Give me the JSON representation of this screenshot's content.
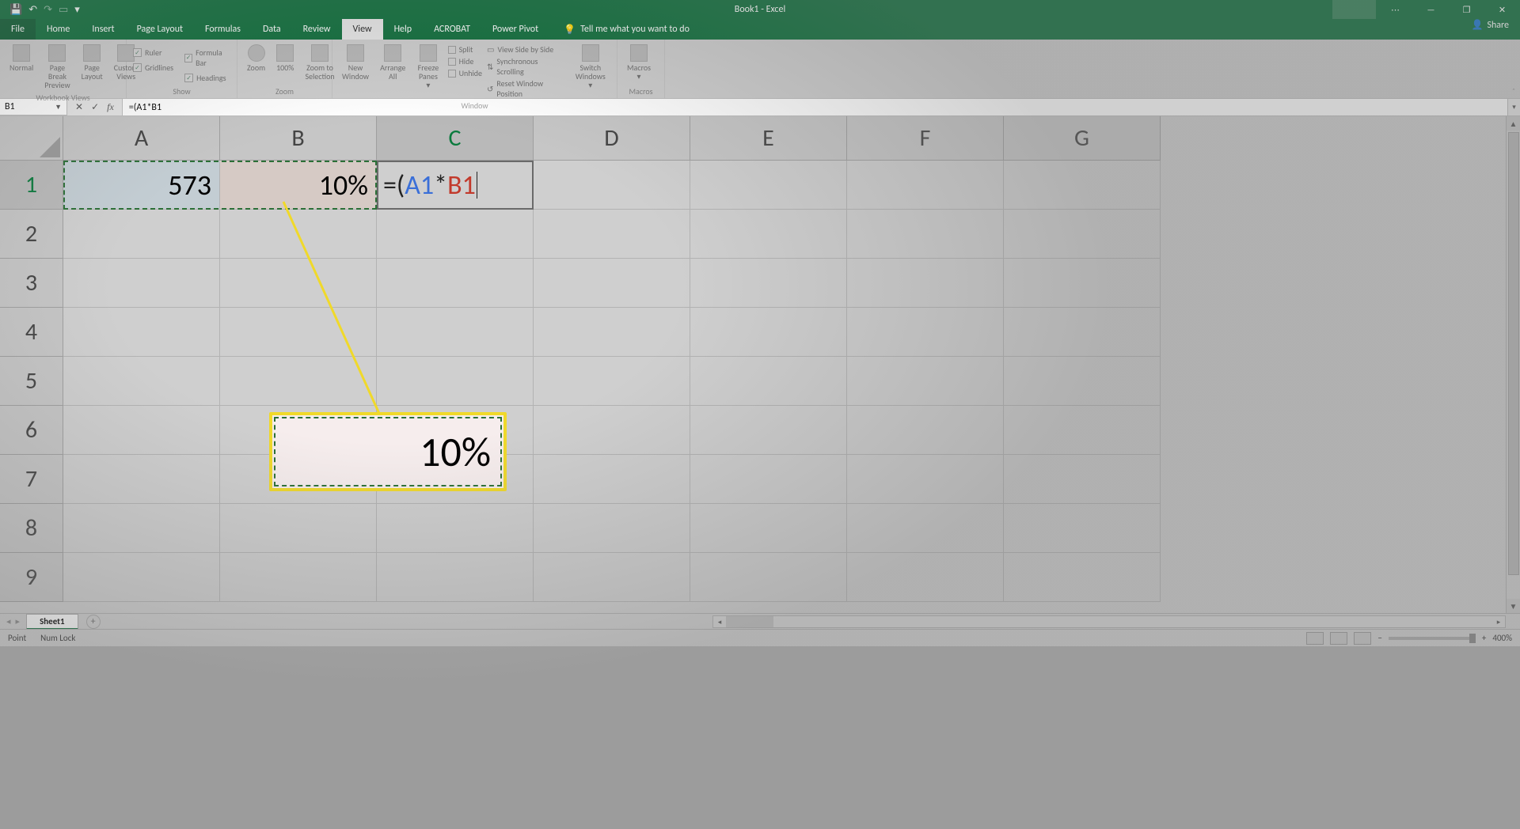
{
  "app": {
    "title": "Book1 - Excel"
  },
  "qat": {
    "save": "💾",
    "undo": "↶",
    "redo": "↷",
    "touch": "▭",
    "more": "▾"
  },
  "win": {
    "ribbon_opts": "⋯",
    "min": "—",
    "max": "❐",
    "close": "✕"
  },
  "tabs": {
    "file": "File",
    "home": "Home",
    "insert": "Insert",
    "page_layout": "Page Layout",
    "formulas": "Formulas",
    "data": "Data",
    "review": "Review",
    "view": "View",
    "help": "Help",
    "acrobat": "ACROBAT",
    "power_pivot": "Power Pivot",
    "tell_me": "Tell me what you want to do",
    "share": "Share"
  },
  "ribbon": {
    "workbook_views": {
      "label": "Workbook Views",
      "normal": "Normal",
      "page_break": "Page Break\nPreview",
      "page_layout": "Page\nLayout",
      "custom": "Custom\nViews"
    },
    "show": {
      "label": "Show",
      "ruler": "Ruler",
      "formula_bar": "Formula Bar",
      "gridlines": "Gridlines",
      "headings": "Headings"
    },
    "zoom": {
      "label": "Zoom",
      "zoom": "Zoom",
      "pct": "100%",
      "to_sel": "Zoom to\nSelection"
    },
    "window": {
      "label": "Window",
      "new": "New\nWindow",
      "arrange": "Arrange\nAll",
      "freeze": "Freeze\nPanes ▾",
      "split": "Split",
      "hide": "Hide",
      "unhide": "Unhide",
      "side": "View Side by Side",
      "sync": "Synchronous Scrolling",
      "reset": "Reset Window Position",
      "switch": "Switch\nWindows ▾"
    },
    "macros": {
      "label": "Macros",
      "macros": "Macros\n▾"
    }
  },
  "formula_bar": {
    "name_box": "B1",
    "cancel": "✕",
    "enter": "✓",
    "fx": "fx",
    "formula": "=(A1*B1"
  },
  "columns": [
    "A",
    "B",
    "C",
    "D",
    "E",
    "F",
    "G"
  ],
  "rows": [
    "1",
    "2",
    "3",
    "4",
    "5",
    "6",
    "7",
    "8",
    "9"
  ],
  "cells": {
    "A1": "573",
    "B1": "10%",
    "C1_eq": "=(",
    "C1_a1": "A1",
    "C1_star": "*",
    "C1_b1": "B1"
  },
  "callout": {
    "value": "10%"
  },
  "sheet": {
    "name": "Sheet1",
    "add": "+",
    "nav_l": "◂",
    "nav_r": "▸"
  },
  "status": {
    "mode": "Point",
    "numlock": "Num Lock",
    "zoom": "400%"
  }
}
